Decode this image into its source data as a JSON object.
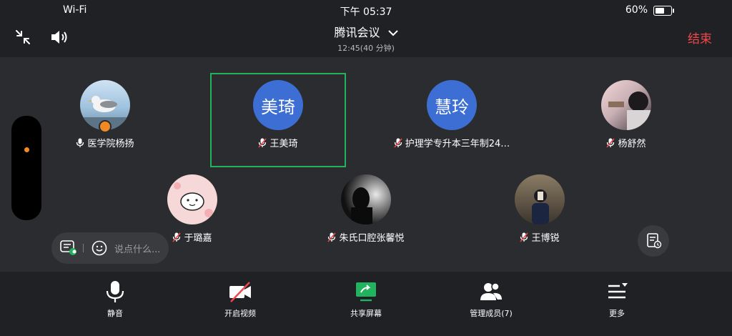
{
  "status": {
    "network": "Wi-Fi",
    "time": "下午 05:37",
    "battery": "60%",
    "battery_level": 0.6
  },
  "header": {
    "title": "腾讯会议",
    "subtitle": "12:45(40 分钟)",
    "end_label": "结束",
    "icons": [
      "minimize-icon",
      "speaker-icon",
      "chevron-down-icon"
    ]
  },
  "participants": [
    {
      "name": "医学院杨扬",
      "avatar": "seagull-photo",
      "mic": "on",
      "host": true
    },
    {
      "name": "王美琦",
      "avatar_text": "美琦",
      "mic": "muted",
      "active_speaker": true
    },
    {
      "name": "护理学专升本三年制24…",
      "avatar_text": "慧玲",
      "mic": "muted"
    },
    {
      "name": "杨舒然",
      "avatar": "person-photo",
      "mic": "muted"
    },
    {
      "name": "于璐嘉",
      "avatar": "cartoon-photo",
      "mic": "muted"
    },
    {
      "name": "朱氏口腔张馨悦",
      "avatar": "dark-silhouette-photo",
      "mic": "muted"
    },
    {
      "name": "王博锐",
      "avatar": "mirror-selfie-photo",
      "mic": "muted"
    }
  ],
  "chat": {
    "placeholder": "说点什么..."
  },
  "toolbar": {
    "mute": "静音",
    "video": "开启视频",
    "share": "共享屏幕",
    "members": "管理成员(7)",
    "more": "更多"
  },
  "colors": {
    "accent_green": "#22b35e",
    "end_red": "#f0474a",
    "avatar_blue": "#3d6ed3",
    "host_orange": "#f08a24"
  }
}
